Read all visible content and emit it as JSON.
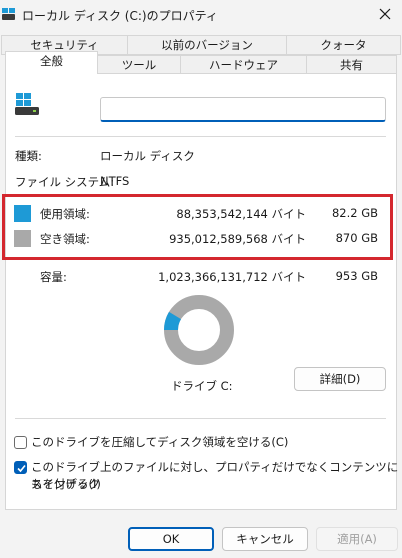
{
  "window": {
    "title": "ローカル ディスク (C:)のプロパティ"
  },
  "tabs": {
    "row1": [
      {
        "label": "セキュリティ"
      },
      {
        "label": "以前のバージョン"
      },
      {
        "label": "クォータ"
      }
    ],
    "row2": [
      {
        "label": "全般",
        "selected": true
      },
      {
        "label": "ツール"
      },
      {
        "label": "ハードウェア"
      },
      {
        "label": "共有"
      }
    ]
  },
  "general": {
    "name_value": "",
    "type_label": "種類:",
    "type_value": "ローカル ディスク",
    "fs_label": "ファイル システム:",
    "fs_value": "NTFS",
    "used": {
      "label": "使用領域:",
      "bytes": "88,353,542,144 バイト",
      "size": "82.2 GB",
      "color": "#1e9ad6"
    },
    "free": {
      "label": "空き領域:",
      "bytes": "935,012,589,568 バイト",
      "size": "870 GB",
      "color": "#a9a9a9"
    },
    "capacity": {
      "label": "容量:",
      "bytes": "1,023,366,131,712 バイト",
      "size": "953 GB"
    },
    "used_fraction": 0.0863,
    "drive_label": "ドライブ C:",
    "details_button": "詳細(D)",
    "compress_option": {
      "label": "このドライブを圧縮してディスク領域を空ける(C)",
      "checked": false
    },
    "index_option": {
      "label_line1": "このドライブ上のファイルに対し、プロパティだけでなくコンテンツにもインデック",
      "label_line2": "スを付ける(I)",
      "checked": true
    }
  },
  "buttons": {
    "ok": "OK",
    "cancel": "キャンセル",
    "apply": "適用(A)"
  },
  "colors": {
    "accent": "#005fb8",
    "highlight_border": "#d4272e"
  }
}
